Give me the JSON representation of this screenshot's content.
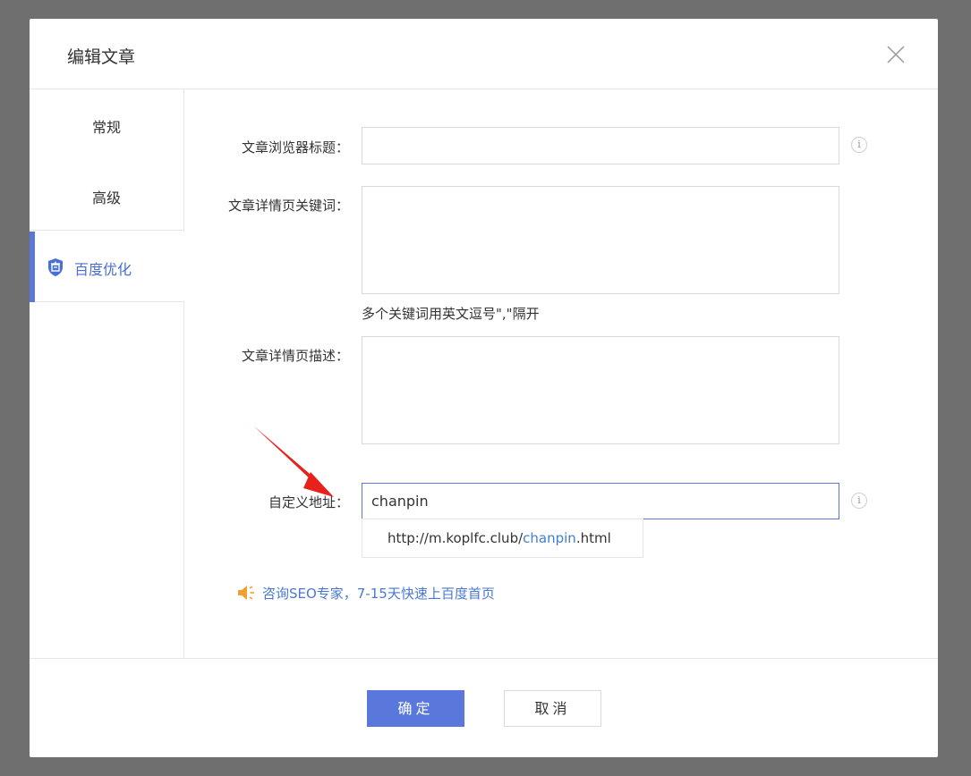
{
  "dialog": {
    "title": "编辑文章"
  },
  "sidebar": {
    "tabs": [
      {
        "label": "常规"
      },
      {
        "label": "高级"
      },
      {
        "label": "百度优化",
        "active": true,
        "icon": "shield-shop-icon"
      }
    ],
    "accent_color": "#5a78dc"
  },
  "form": {
    "browser_title": {
      "label": "文章浏览器标题：",
      "value": ""
    },
    "keywords": {
      "label": "文章详情页关键词：",
      "value": "",
      "hint": "多个关键词用英文逗号\",\"隔开"
    },
    "description": {
      "label": "文章详情页描述：",
      "value": ""
    },
    "custom_url": {
      "label": "自定义地址：",
      "value": "chanpin",
      "preview_prefix": "http://m.koplfc.club/",
      "preview_slug": "chanpin",
      "preview_suffix": ".html"
    }
  },
  "promo": {
    "text": "咨询SEO专家，7-15天快速上百度首页",
    "icon": "speaker-icon",
    "icon_color": "#f0a030"
  },
  "footer": {
    "ok_label": "确定",
    "cancel_label": "取消"
  },
  "info_icon_glyph": "i"
}
